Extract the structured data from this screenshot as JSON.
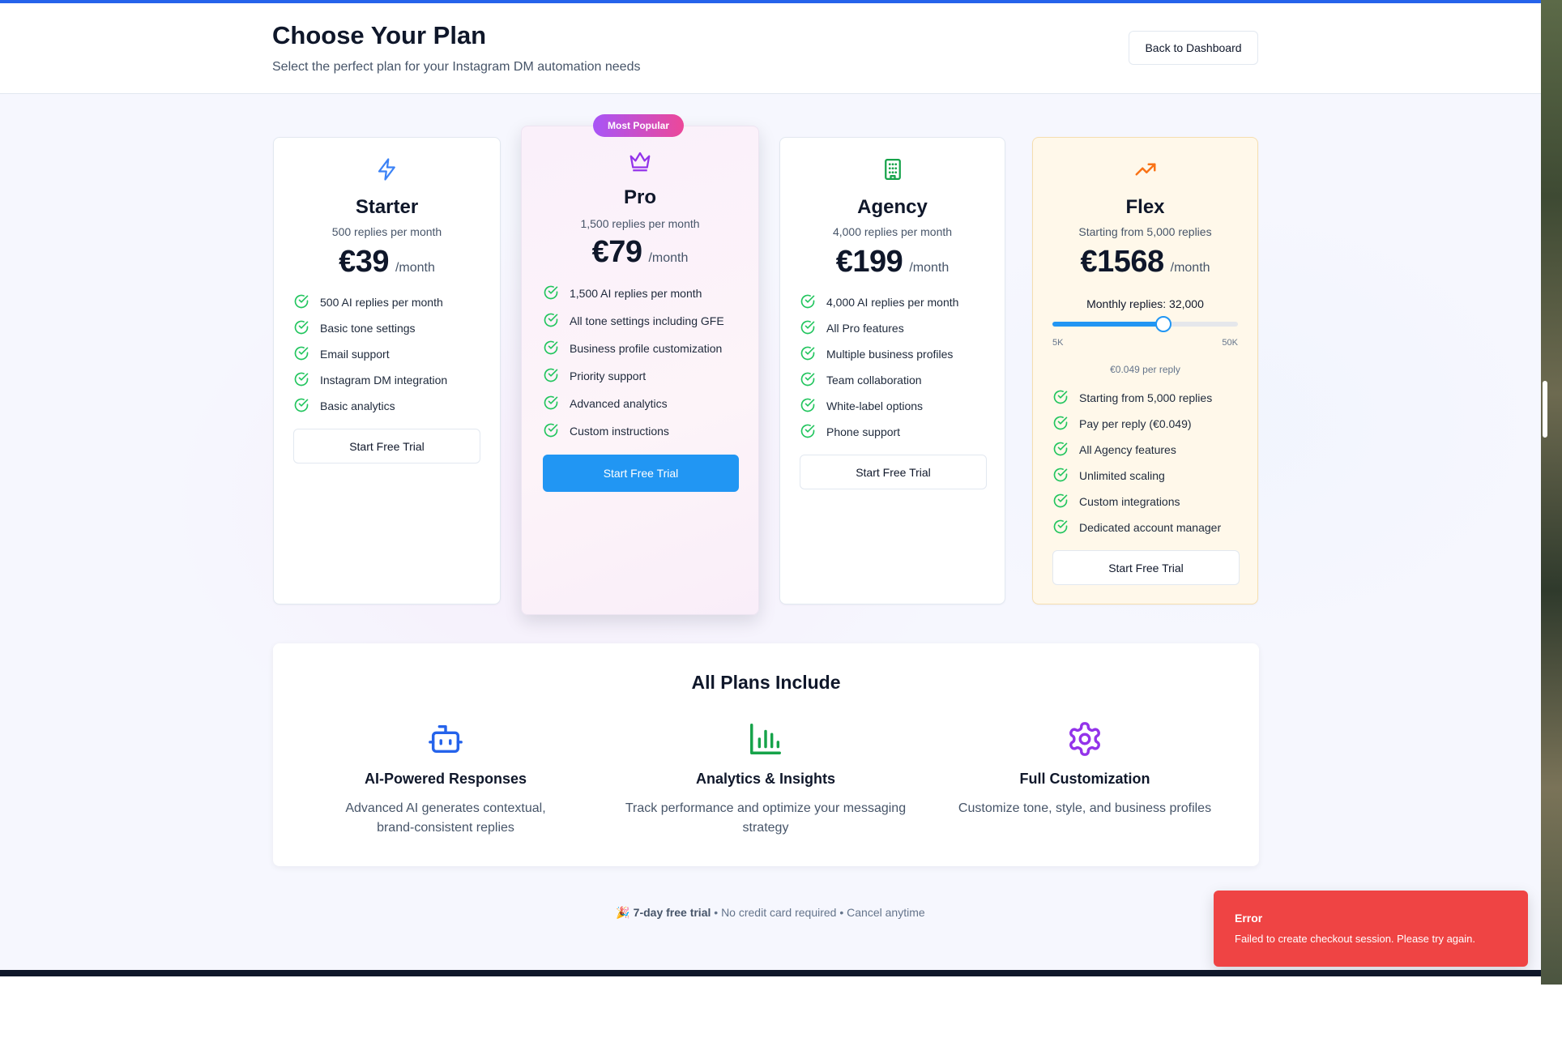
{
  "header": {
    "title": "Choose Your Plan",
    "subtitle": "Select the perfect plan for your Instagram DM automation needs",
    "back_button": "Back to Dashboard"
  },
  "plans": [
    {
      "name": "Starter",
      "description": "500 replies per month",
      "price": "€39",
      "period": "/month",
      "icon": "lightning-icon",
      "features": [
        "500 AI replies per month",
        "Basic tone settings",
        "Email support",
        "Instagram DM integration",
        "Basic analytics"
      ],
      "cta": "Start Free Trial"
    },
    {
      "name": "Pro",
      "badge": "Most Popular",
      "description": "1,500 replies per month",
      "price": "€79",
      "period": "/month",
      "icon": "crown-icon",
      "features": [
        "1,500 AI replies per month",
        "All tone settings including GFE",
        "Business profile customization",
        "Priority support",
        "Advanced analytics",
        "Custom instructions"
      ],
      "cta": "Start Free Trial"
    },
    {
      "name": "Agency",
      "description": "4,000 replies per month",
      "price": "€199",
      "period": "/month",
      "icon": "building-icon",
      "features": [
        "4,000 AI replies per month",
        "All Pro features",
        "Multiple business profiles",
        "Team collaboration",
        "White-label options",
        "Phone support"
      ],
      "cta": "Start Free Trial"
    },
    {
      "name": "Flex",
      "description": "Starting from 5,000 replies",
      "price": "€1568",
      "period": "/month",
      "icon": "trending-up-icon",
      "slider": {
        "label": "Monthly replies: 32,000",
        "min_label": "5K",
        "max_label": "50K",
        "min": 5000,
        "max": 50000,
        "value": 32000
      },
      "per_reply": "€0.049 per reply",
      "features": [
        "Starting from 5,000 replies",
        "Pay per reply (€0.049)",
        "All Agency features",
        "Unlimited scaling",
        "Custom integrations",
        "Dedicated account manager"
      ],
      "cta": "Start Free Trial"
    }
  ],
  "includes": {
    "title": "All Plans Include",
    "items": [
      {
        "title": "AI-Powered Responses",
        "description": "Advanced AI generates contextual, brand-consistent replies",
        "icon": "robot-icon"
      },
      {
        "title": "Analytics & Insights",
        "description": "Track performance and optimize your messaging strategy",
        "icon": "bar-chart-icon"
      },
      {
        "title": "Full Customization",
        "description": "Customize tone, style, and business profiles",
        "icon": "gear-icon"
      }
    ]
  },
  "footer": {
    "emoji": "🎉",
    "trial": "7-day free trial",
    "separator": "•",
    "no_card": "No credit card required",
    "cancel": "Cancel anytime"
  },
  "toast": {
    "title": "Error",
    "message": "Failed to create checkout session. Please try again."
  },
  "colors": {
    "accent": "#2196f3",
    "success": "#22c55e",
    "error": "#ef4444",
    "badge_start": "#a855f7",
    "badge_end": "#ec4899"
  }
}
